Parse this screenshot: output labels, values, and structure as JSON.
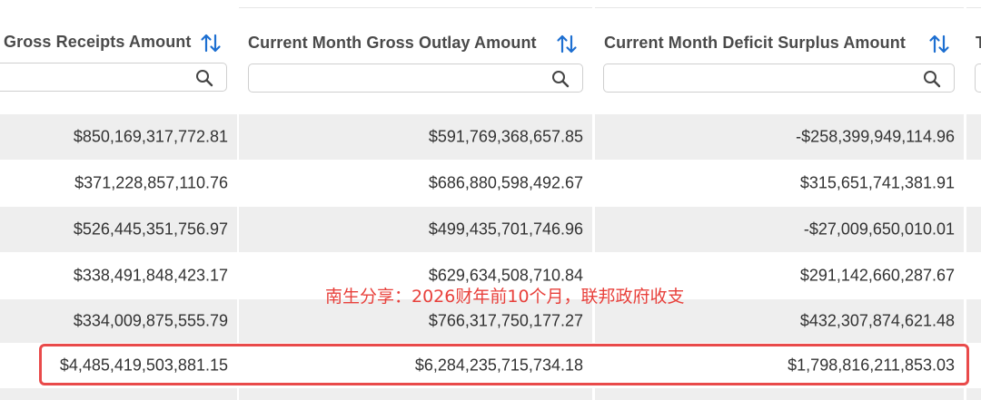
{
  "columns": [
    {
      "title": "Gross Receipts Amount",
      "sort_icon": "sort-arrows-icon",
      "search_icon": "magnifier-icon"
    },
    {
      "title": "Current Month Gross Outlay Amount",
      "sort_icon": "sort-arrows-icon",
      "search_icon": "magnifier-icon"
    },
    {
      "title": "Current Month Deficit Surplus Amount",
      "sort_icon": "sort-arrows-icon",
      "search_icon": "magnifier-icon"
    },
    {
      "title": "T"
    }
  ],
  "rows": [
    {
      "receipts": "$850,169,317,772.81",
      "outlay": "$591,769,368,657.85",
      "deficit": "-$258,399,949,114.96"
    },
    {
      "receipts": "$371,228,857,110.76",
      "outlay": "$686,880,598,492.67",
      "deficit": "$315,651,741,381.91"
    },
    {
      "receipts": "$526,445,351,756.97",
      "outlay": "$499,435,701,746.96",
      "deficit": "-$27,009,650,010.01"
    },
    {
      "receipts": "$338,491,848,423.17",
      "outlay": "$629,634,508,710.84",
      "deficit": "$291,142,660,287.67"
    },
    {
      "receipts": "$334,009,875,555.79",
      "outlay": "$766,317,750,177.27",
      "deficit": "$432,307,874,621.48"
    },
    {
      "receipts": "$4,485,419,503,881.15",
      "outlay": "$6,284,235,715,734.18",
      "deficit": "$1,798,816,211,853.03"
    }
  ],
  "overlay_text": "南生分享：2026财年前10个月，联邦政府收支",
  "colors": {
    "accent": "#1d6fd1",
    "highlight": "#e94a4a",
    "overlay_text": "#e8413c",
    "row_shade": "#eeeeee"
  }
}
